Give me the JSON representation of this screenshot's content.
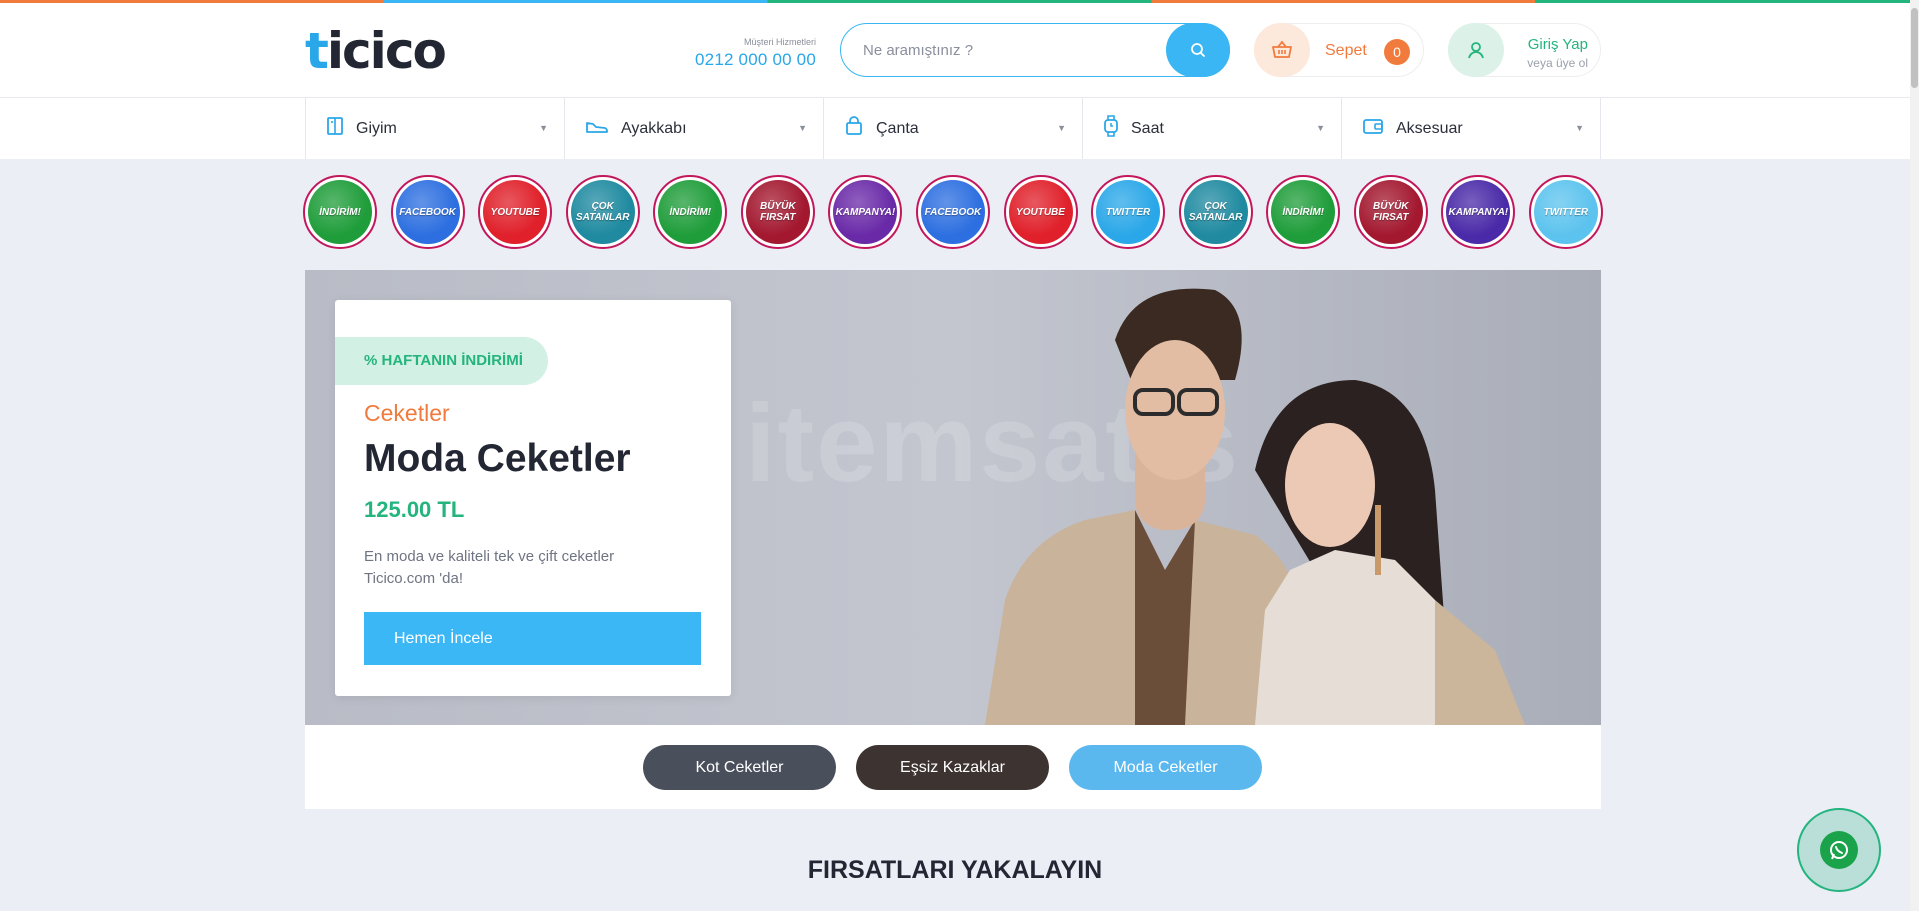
{
  "brand": {
    "logo_text": "ticico",
    "logo_first": "t",
    "logo_rest": "icico"
  },
  "support": {
    "label": "Müşteri Hizmetleri",
    "phone": "0212 000 00 00"
  },
  "search": {
    "placeholder": "Ne aramıştınız ?"
  },
  "cart": {
    "label": "Sepet",
    "count": "0"
  },
  "login": {
    "title": "Giriş Yap",
    "subtitle": "veya üye ol"
  },
  "categories": [
    {
      "label": "Giyim",
      "icon": "shirt-icon"
    },
    {
      "label": "Ayakkabı",
      "icon": "shoe-icon"
    },
    {
      "label": "Çanta",
      "icon": "bag-icon"
    },
    {
      "label": "Saat",
      "icon": "watch-icon"
    },
    {
      "label": "Aksesuar",
      "icon": "wallet-icon"
    }
  ],
  "stories": [
    {
      "label": "İNDİRİM!",
      "color": "#1f9d3a"
    },
    {
      "label": "FACEBOOK",
      "color": "#2d6fe0"
    },
    {
      "label": "YOUTUBE",
      "color": "#e0202a"
    },
    {
      "label": "ÇOK SATANLAR",
      "color": "#1f8aa0"
    },
    {
      "label": "İNDİRİM!",
      "color": "#1f9d3a"
    },
    {
      "label": "BÜYÜK FIRSAT",
      "color": "#a3182f"
    },
    {
      "label": "KAMPANYA!",
      "color": "#6a2aa8"
    },
    {
      "label": "FACEBOOK",
      "color": "#2d6fe0"
    },
    {
      "label": "YOUTUBE",
      "color": "#e0202a"
    },
    {
      "label": "TWITTER",
      "color": "#2aa7e8"
    },
    {
      "label": "ÇOK SATANLAR",
      "color": "#1f8aa0"
    },
    {
      "label": "İNDİRİM!",
      "color": "#1f9d3a"
    },
    {
      "label": "BÜYÜK FIRSAT",
      "color": "#a3182f"
    },
    {
      "label": "KAMPANYA!",
      "color": "#4a2aa8"
    },
    {
      "label": "TWITTER",
      "color": "#5cc3ee"
    }
  ],
  "hero": {
    "badge": "% HAFTANIN İNDİRİMİ",
    "subtitle": "Ceketler",
    "title": "Moda Ceketler",
    "price": "125.00 TL",
    "description": "En moda ve kaliteli tek ve çift ceketler Ticico.com 'da!",
    "cta": "Hemen İncele",
    "watermark": "itemsatis"
  },
  "slider_tabs": [
    {
      "label": "Kot Ceketler",
      "color": "#4a4f5c"
    },
    {
      "label": "Eşsiz Kazaklar",
      "color": "#3d3330"
    },
    {
      "label": "Moda Ceketler",
      "color": "#5bb8ef"
    }
  ],
  "section_title": "FIRSATLARI YAKALAYIN",
  "colors": {
    "accent_blue": "#39b6f3",
    "accent_orange": "#f07b3c",
    "accent_green": "#24b47e"
  }
}
